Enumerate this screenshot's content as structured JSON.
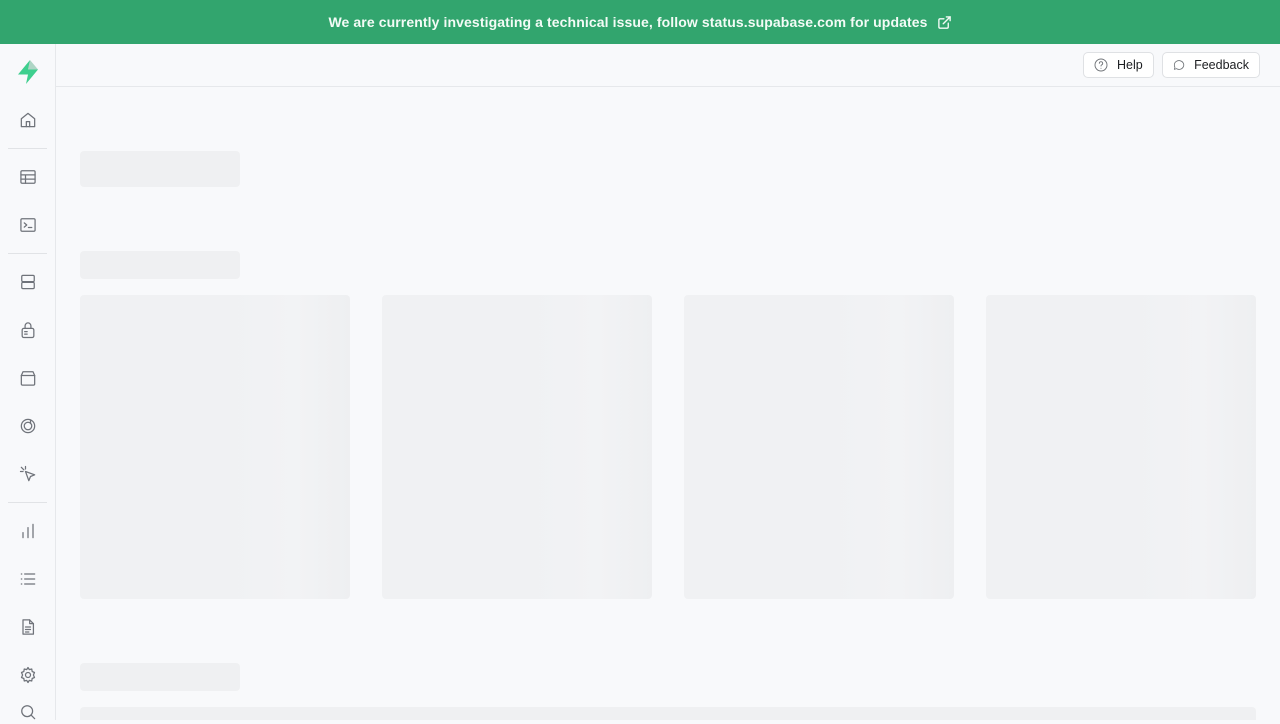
{
  "banner": {
    "message": "We are currently investigating a technical issue, follow status.supabase.com for updates",
    "color": "#32a56e",
    "icon": "external-link-icon"
  },
  "sidebar": {
    "logo": "supabase-logo",
    "items": [
      {
        "name": "home",
        "icon": "home-icon"
      },
      {
        "name": "table-editor",
        "icon": "table-icon"
      },
      {
        "name": "sql-editor",
        "icon": "terminal-icon"
      },
      {
        "name": "database",
        "icon": "database-icon"
      },
      {
        "name": "authentication",
        "icon": "lock-icon"
      },
      {
        "name": "storage",
        "icon": "archive-icon"
      },
      {
        "name": "edge-functions",
        "icon": "functions-icon"
      },
      {
        "name": "realtime",
        "icon": "pointer-icon"
      },
      {
        "name": "reports",
        "icon": "bar-chart-icon"
      },
      {
        "name": "logs",
        "icon": "list-icon"
      },
      {
        "name": "api-docs",
        "icon": "document-icon"
      },
      {
        "name": "settings",
        "icon": "gear-icon"
      },
      {
        "name": "search",
        "icon": "search-icon"
      }
    ]
  },
  "topbar": {
    "help_label": "Help",
    "feedback_label": "Feedback"
  }
}
